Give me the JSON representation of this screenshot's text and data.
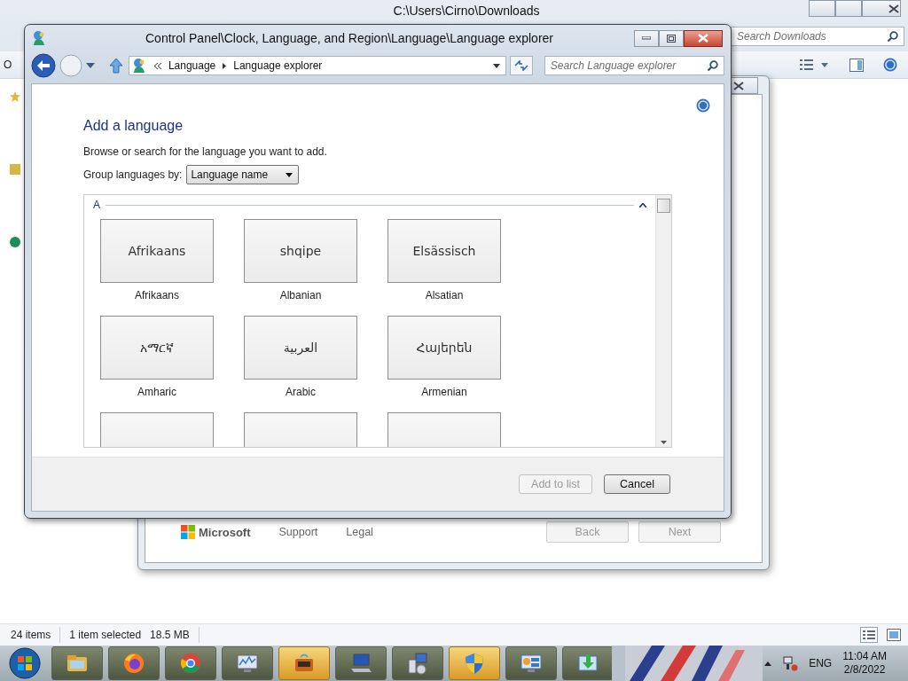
{
  "explorer": {
    "title": "C:\\Users\\Cirno\\Downloads",
    "toolbar_button": "O",
    "search": {
      "placeholder": "Search Downloads"
    },
    "status": {
      "items": "24 items",
      "selection": "1 item selected",
      "size": "18.5 MB"
    }
  },
  "setup_window": {
    "brand": "Microsoft",
    "links": [
      "Support",
      "Legal"
    ],
    "buttons": [
      {
        "label": "Back",
        "disabled": true
      },
      {
        "label": "Next",
        "disabled": true
      }
    ]
  },
  "dialog": {
    "title": "Control Panel\\Clock, Language, and Region\\Language\\Language explorer",
    "breadcrumb": [
      "Language",
      "Language explorer"
    ],
    "search": {
      "placeholder": "Search Language explorer"
    },
    "heading": "Add a language",
    "instructions": "Browse or search for the language you want to add.",
    "group_by": {
      "label": "Group languages by:",
      "value": "Language name"
    },
    "groups": [
      {
        "letter": "A",
        "expanded": true,
        "languages": [
          {
            "kind": "tile",
            "native": "Afrikaans",
            "name": "Afrikaans"
          },
          {
            "kind": "tile",
            "native": "shqipe",
            "name": "Albanian"
          },
          {
            "kind": "tile",
            "native": "Elsässisch",
            "name": "Alsatian"
          },
          {
            "kind": "tile",
            "native": "አማርኛ",
            "name": "Amharic"
          },
          {
            "kind": "tile",
            "native": "العربية",
            "name": "Arabic"
          },
          {
            "kind": "tile",
            "native": "Հայերեն",
            "name": "Armenian"
          },
          {
            "kind": "cut"
          },
          {
            "kind": "cut"
          },
          {
            "kind": "cut"
          }
        ]
      }
    ],
    "buttons": [
      {
        "label": "Add to list",
        "disabled": true
      },
      {
        "label": "Cancel",
        "disabled": false
      }
    ]
  },
  "taskbar": {
    "apps": [
      {
        "highlighted": false
      },
      {
        "highlighted": false
      },
      {
        "highlighted": false
      },
      {
        "highlighted": false
      },
      {
        "highlighted": true
      },
      {
        "highlighted": false
      },
      {
        "highlighted": false
      },
      {
        "highlighted": true
      },
      {
        "highlighted": false
      },
      {
        "highlighted": false
      }
    ],
    "language": "ENG",
    "time": "11:04 AM",
    "date": "2/8/2022"
  }
}
